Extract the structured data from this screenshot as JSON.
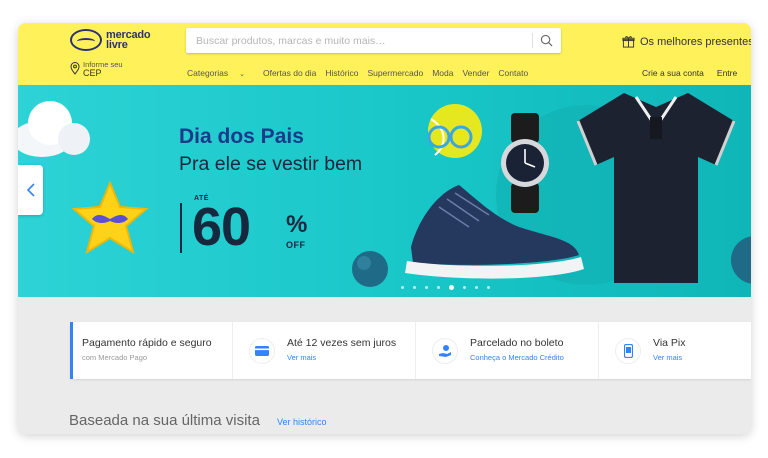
{
  "header": {
    "logo_line1": "mercado",
    "logo_line2": "livre",
    "search_placeholder": "Buscar produtos, marcas e muito mais…",
    "promo_label": "Os melhores presentes",
    "cep_small": "Informe seu",
    "cep_big": "CEP",
    "nav": [
      "Categorias",
      "Ofertas do dia",
      "Histórico",
      "Supermercado",
      "Moda",
      "Vender",
      "Contato"
    ],
    "account": [
      "Crie a sua conta",
      "Entre"
    ]
  },
  "banner": {
    "title": "Dia dos Pais",
    "subtitle": "Pra ele se vestir bem",
    "ate_label": "ATÉ",
    "discount": "60",
    "percent": "%",
    "off": "OFF",
    "slide_count": 8,
    "active_slide": 4
  },
  "payments": [
    {
      "title": "Pagamento rápido e seguro",
      "sub": "com Mercado Pago",
      "icon": "none"
    },
    {
      "title": "Até 12 vezes sem juros",
      "sub": "Ver mais",
      "icon": "credit-card-icon"
    },
    {
      "title": "Parcelado no boleto",
      "sub": "Conheça o Mercado Crédito",
      "icon": "hand-money-icon"
    },
    {
      "title": "Via Pix",
      "sub": "Ver mais",
      "icon": "phone-icon"
    }
  ],
  "section": {
    "title": "Baseada na sua última visita",
    "link": "Ver histórico"
  },
  "colors": {
    "header_bg": "#fff159",
    "brand_blue": "#2d3277",
    "link_blue": "#3483fa",
    "banner_teal": "#18c6c8",
    "banner_title": "#1a3b8a"
  }
}
